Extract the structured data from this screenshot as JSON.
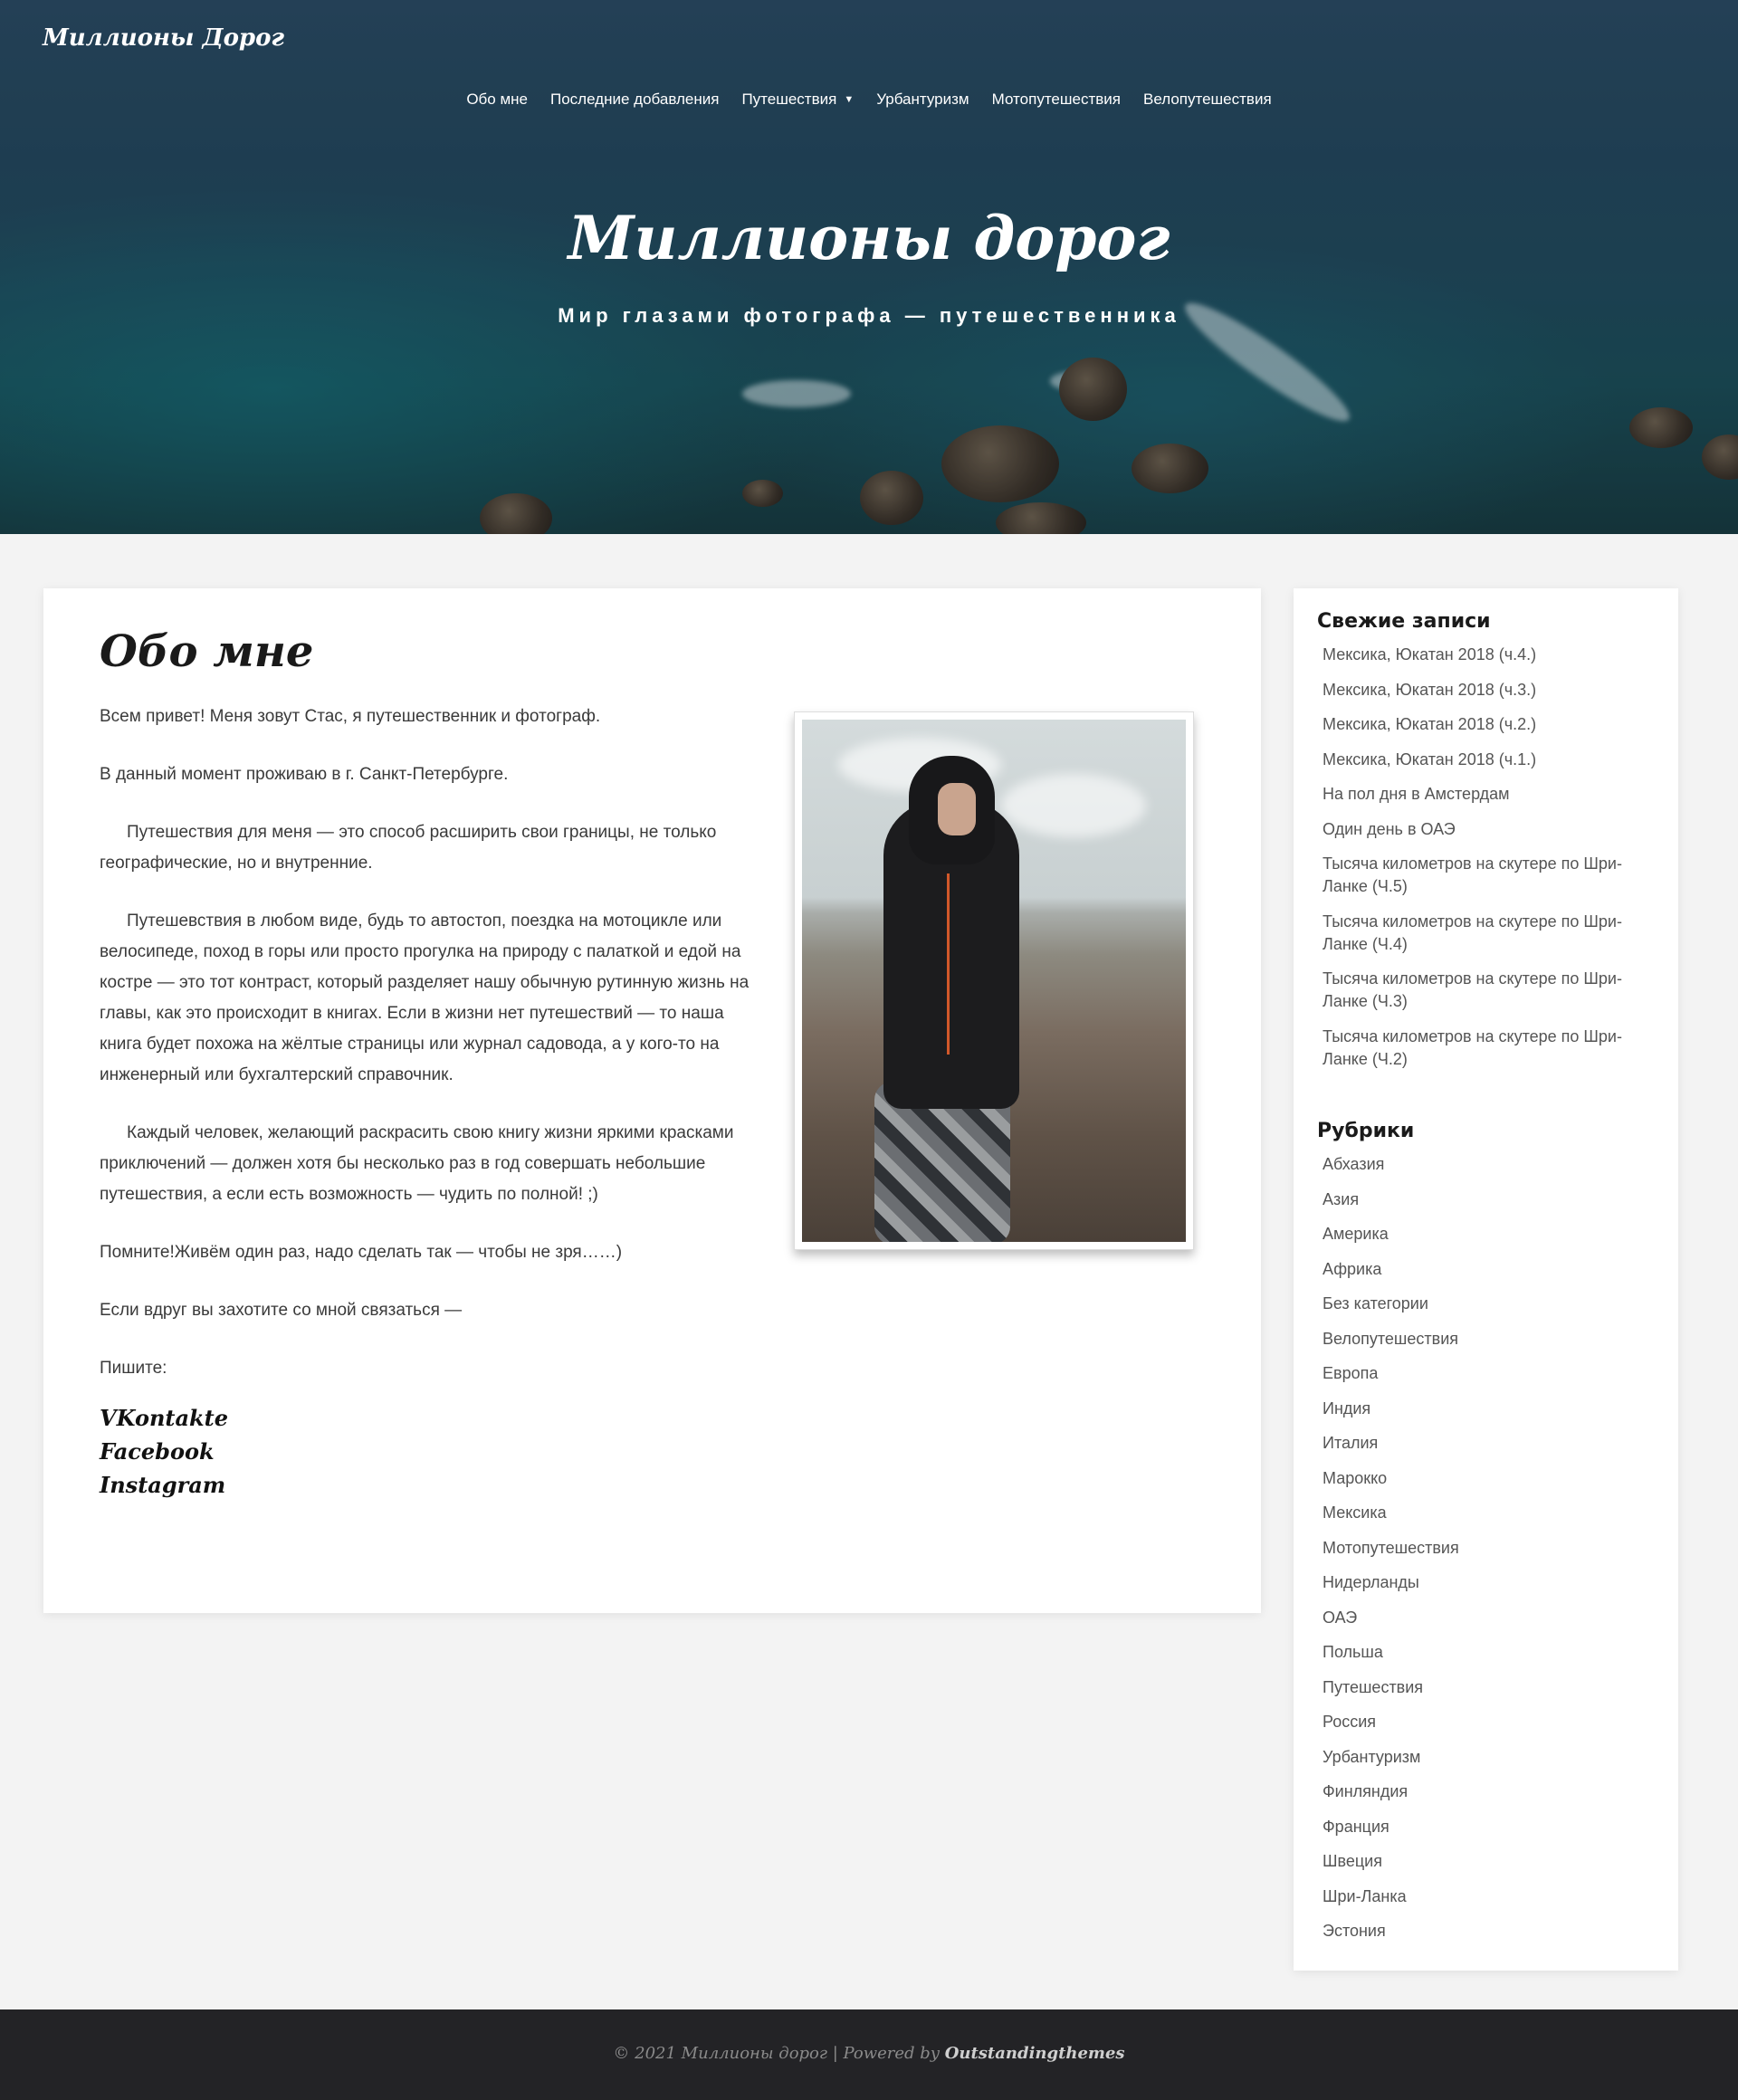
{
  "site": {
    "brand": "Миллионы Дорог",
    "hero_title": "Миллионы дорог",
    "hero_subtitle": "Мир глазами фотографа — путешественника"
  },
  "nav": {
    "items": [
      {
        "label": "Обо мне"
      },
      {
        "label": "Последние добавления"
      },
      {
        "label": "Путешествия",
        "has_dropdown": true
      },
      {
        "label": "Урбантуризм"
      },
      {
        "label": "Мотопутешествия"
      },
      {
        "label": "Велопутешествия"
      }
    ]
  },
  "page": {
    "title": "Обо мне",
    "paragraphs": [
      "Всем привет! Меня зовут Стас, я путешественник и фотограф.",
      "В данный момент проживаю в г. Санкт-Петербурге.",
      "Путешествия для меня  — это способ расширить свои границы, не только географические, но и внутренние.",
      "Путешевствия в любом виде, будь то автостоп, поездка на мотоцикле или велосипеде, поход в горы или просто прогулка на природу с палаткой и едой на костре — это тот контраст, который разделяет нашу обычную рутинную жизнь на главы, как это происходит в книгах. Если в жизни нет путешествий — то наша книга будет похожа на жёлтые страницы или журнал садовода, а у кого-то  на инженерный или бухгалтерский справочник.",
      "Каждый человек, желающий раскрасить свою книгу жизни яркими красками приключений — должен хотя бы несколько раз в год совершать небольшие путешествия, а если есть возможность — чудить по полной!  ;)",
      "Помните!Живём один раз, надо сделать так — чтобы не зря……)",
      "Если вдруг вы захотите со мной связаться —",
      "Пишите:"
    ],
    "social_links": [
      "VKontakte",
      "Facebook",
      "Instagram"
    ]
  },
  "sidebar": {
    "recent_title": "Свежие записи",
    "recent_posts": [
      "Мексика, Юкатан 2018 (ч.4.)",
      "Мексика, Юкатан 2018 (ч.3.)",
      "Мексика, Юкатан 2018 (ч.2.)",
      "Мексика, Юкатан 2018 (ч.1.)",
      "На пол дня в Амстердам",
      "Один день в ОАЭ",
      "Тысяча километров на скутере по Шри-Ланке (Ч.5)",
      "Тысяча километров на скутере по Шри-Ланке (Ч.4)",
      "Тысяча километров на скутере по Шри-Ланке (Ч.3)",
      "Тысяча километров на скутере по Шри-Ланке (Ч.2)"
    ],
    "categories_title": "Рубрики",
    "categories": [
      "Абхазия",
      "Азия",
      "Америка",
      "Африка",
      "Без категории",
      "Велопутешествия",
      "Европа",
      "Индия",
      "Италия",
      "Марокко",
      "Мексика",
      "Мотопутешествия",
      "Нидерланды",
      "ОАЭ",
      "Польша",
      "Путешествия",
      "Россия",
      "Урбантуризм",
      "Финляндия",
      "Франция",
      "Швеция",
      "Шри-Ланка",
      "Эстония"
    ]
  },
  "footer": {
    "text": "© 2021 Миллионы дорог | Powered by ",
    "powered_by": "Outstandingthemes"
  }
}
